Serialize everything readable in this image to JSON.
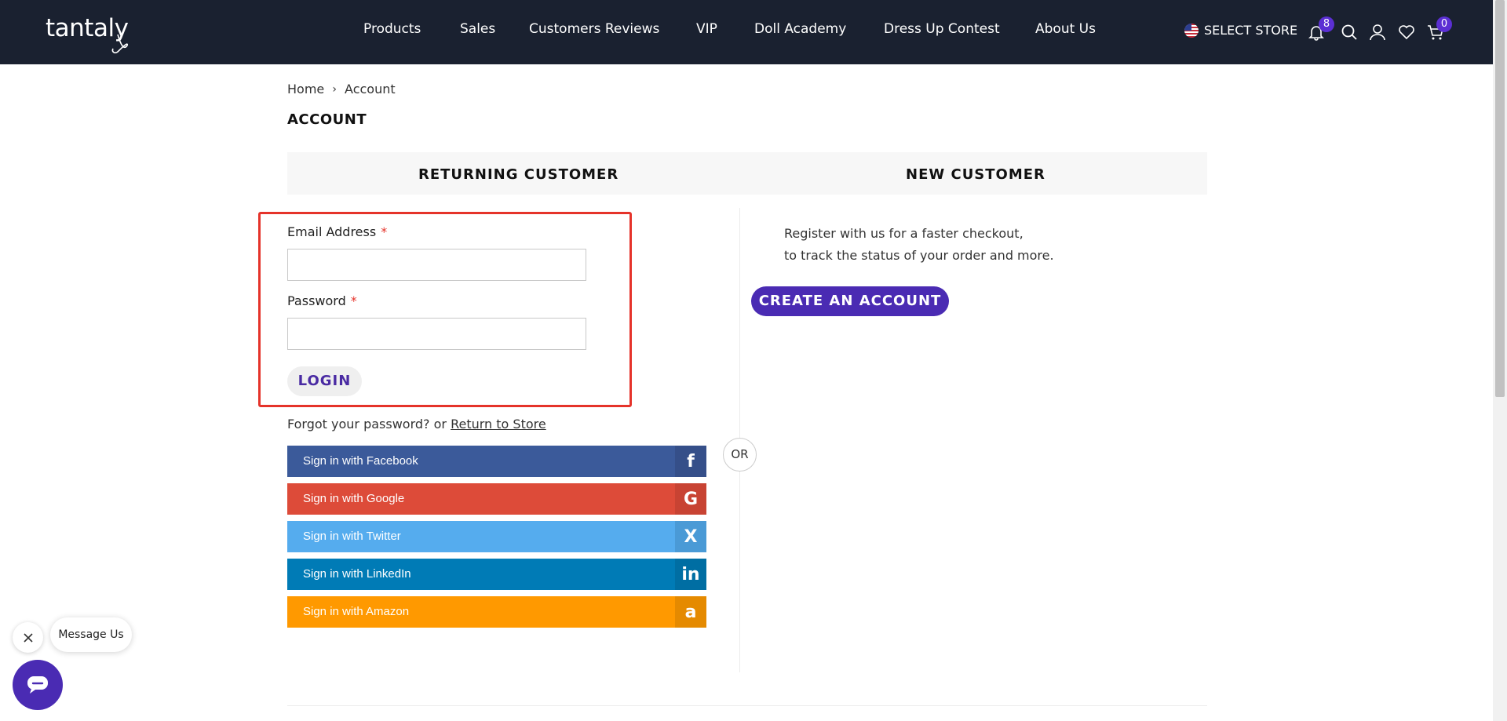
{
  "header": {
    "logo_text": "tantaly",
    "nav": [
      "Products",
      "Sales",
      "Customers Reviews",
      "VIP",
      "Doll Academy",
      "Dress Up Contest",
      "About Us"
    ],
    "store_label": "SELECT STORE",
    "notification_count": "8",
    "cart_count": "0"
  },
  "breadcrumb": {
    "home": "Home",
    "separator": "›",
    "current": "Account"
  },
  "page_title": "ACCOUNT",
  "tabs": {
    "returning": "RETURNING CUSTOMER",
    "new": "NEW CUSTOMER"
  },
  "login": {
    "email_label": "Email Address",
    "password_label": "Password",
    "required_mark": "*",
    "email_value": "",
    "password_value": "",
    "login_button": "LOGIN",
    "forgot_text": "Forgot your password? or",
    "return_link": "Return to Store"
  },
  "or_label": "OR",
  "social": [
    {
      "label": "Sign in with Facebook",
      "icon": "f",
      "color": "#3b5a9a",
      "icon_bg": "#354f89",
      "icon_name": "facebook-icon"
    },
    {
      "label": "Sign in with Google",
      "icon": "G",
      "color": "#dd4b39",
      "icon_bg": "#c84333",
      "icon_name": "google-icon"
    },
    {
      "label": "Sign in with Twitter",
      "icon": "X",
      "color": "#55acee",
      "icon_bg": "#4a9ad6",
      "icon_name": "x-icon"
    },
    {
      "label": "Sign in with LinkedIn",
      "icon": "in",
      "color": "#007bb6",
      "icon_bg": "#006ea3",
      "icon_name": "linkedin-icon"
    },
    {
      "label": "Sign in with Amazon",
      "icon": "a",
      "color": "#ff9900",
      "icon_bg": "#e58a00",
      "icon_name": "amazon-icon"
    }
  ],
  "new_customer": {
    "line1": "Register with us for a faster checkout,",
    "line2": "to track the status of your order and more.",
    "create_button": "CREATE AN ACCOUNT"
  },
  "chat": {
    "message_label": "Message Us"
  },
  "colors": {
    "header_bg": "#1a2130",
    "accent": "#4a2bb3",
    "highlight": "#e5332a"
  }
}
